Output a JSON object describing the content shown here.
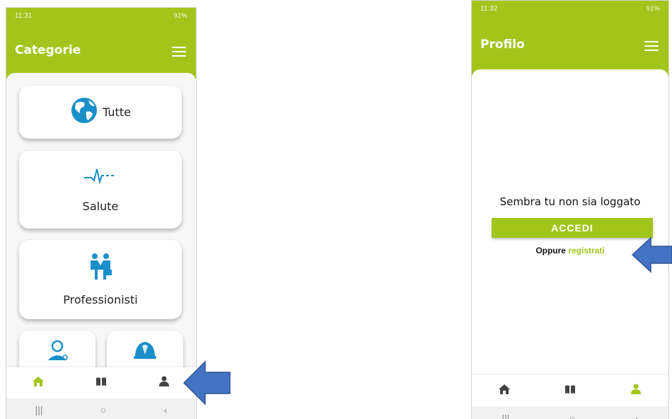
{
  "left_screen": {
    "status": {
      "time": "11:31",
      "right": "92%"
    },
    "title": "Categorie",
    "categories": [
      {
        "label": "Tutte",
        "icon": "globe-icon"
      },
      {
        "label": "Salute",
        "icon": "heartbeat-icon"
      },
      {
        "label": "Professionisti",
        "icon": "handshake-icon"
      },
      {
        "label": "",
        "icon": "workers-icon"
      },
      {
        "label": "",
        "icon": "helmet-icon"
      }
    ],
    "nav": {
      "active": "home",
      "items": [
        "home-icon",
        "book-icon",
        "user-icon"
      ]
    }
  },
  "right_screen": {
    "status": {
      "time": "11:32",
      "right": "92%"
    },
    "title": "Profilo",
    "message": "Sembra tu non sia loggato",
    "login_button": "ACCEDI",
    "or_text": "Oppure",
    "register_link": "registrati",
    "nav": {
      "active": "profile",
      "items": [
        "home-icon",
        "book-icon",
        "user-icon"
      ]
    }
  },
  "colors": {
    "accent": "#a2c51c",
    "icon_blue": "#1a8fc9",
    "arrow_blue": "#4472c4"
  }
}
